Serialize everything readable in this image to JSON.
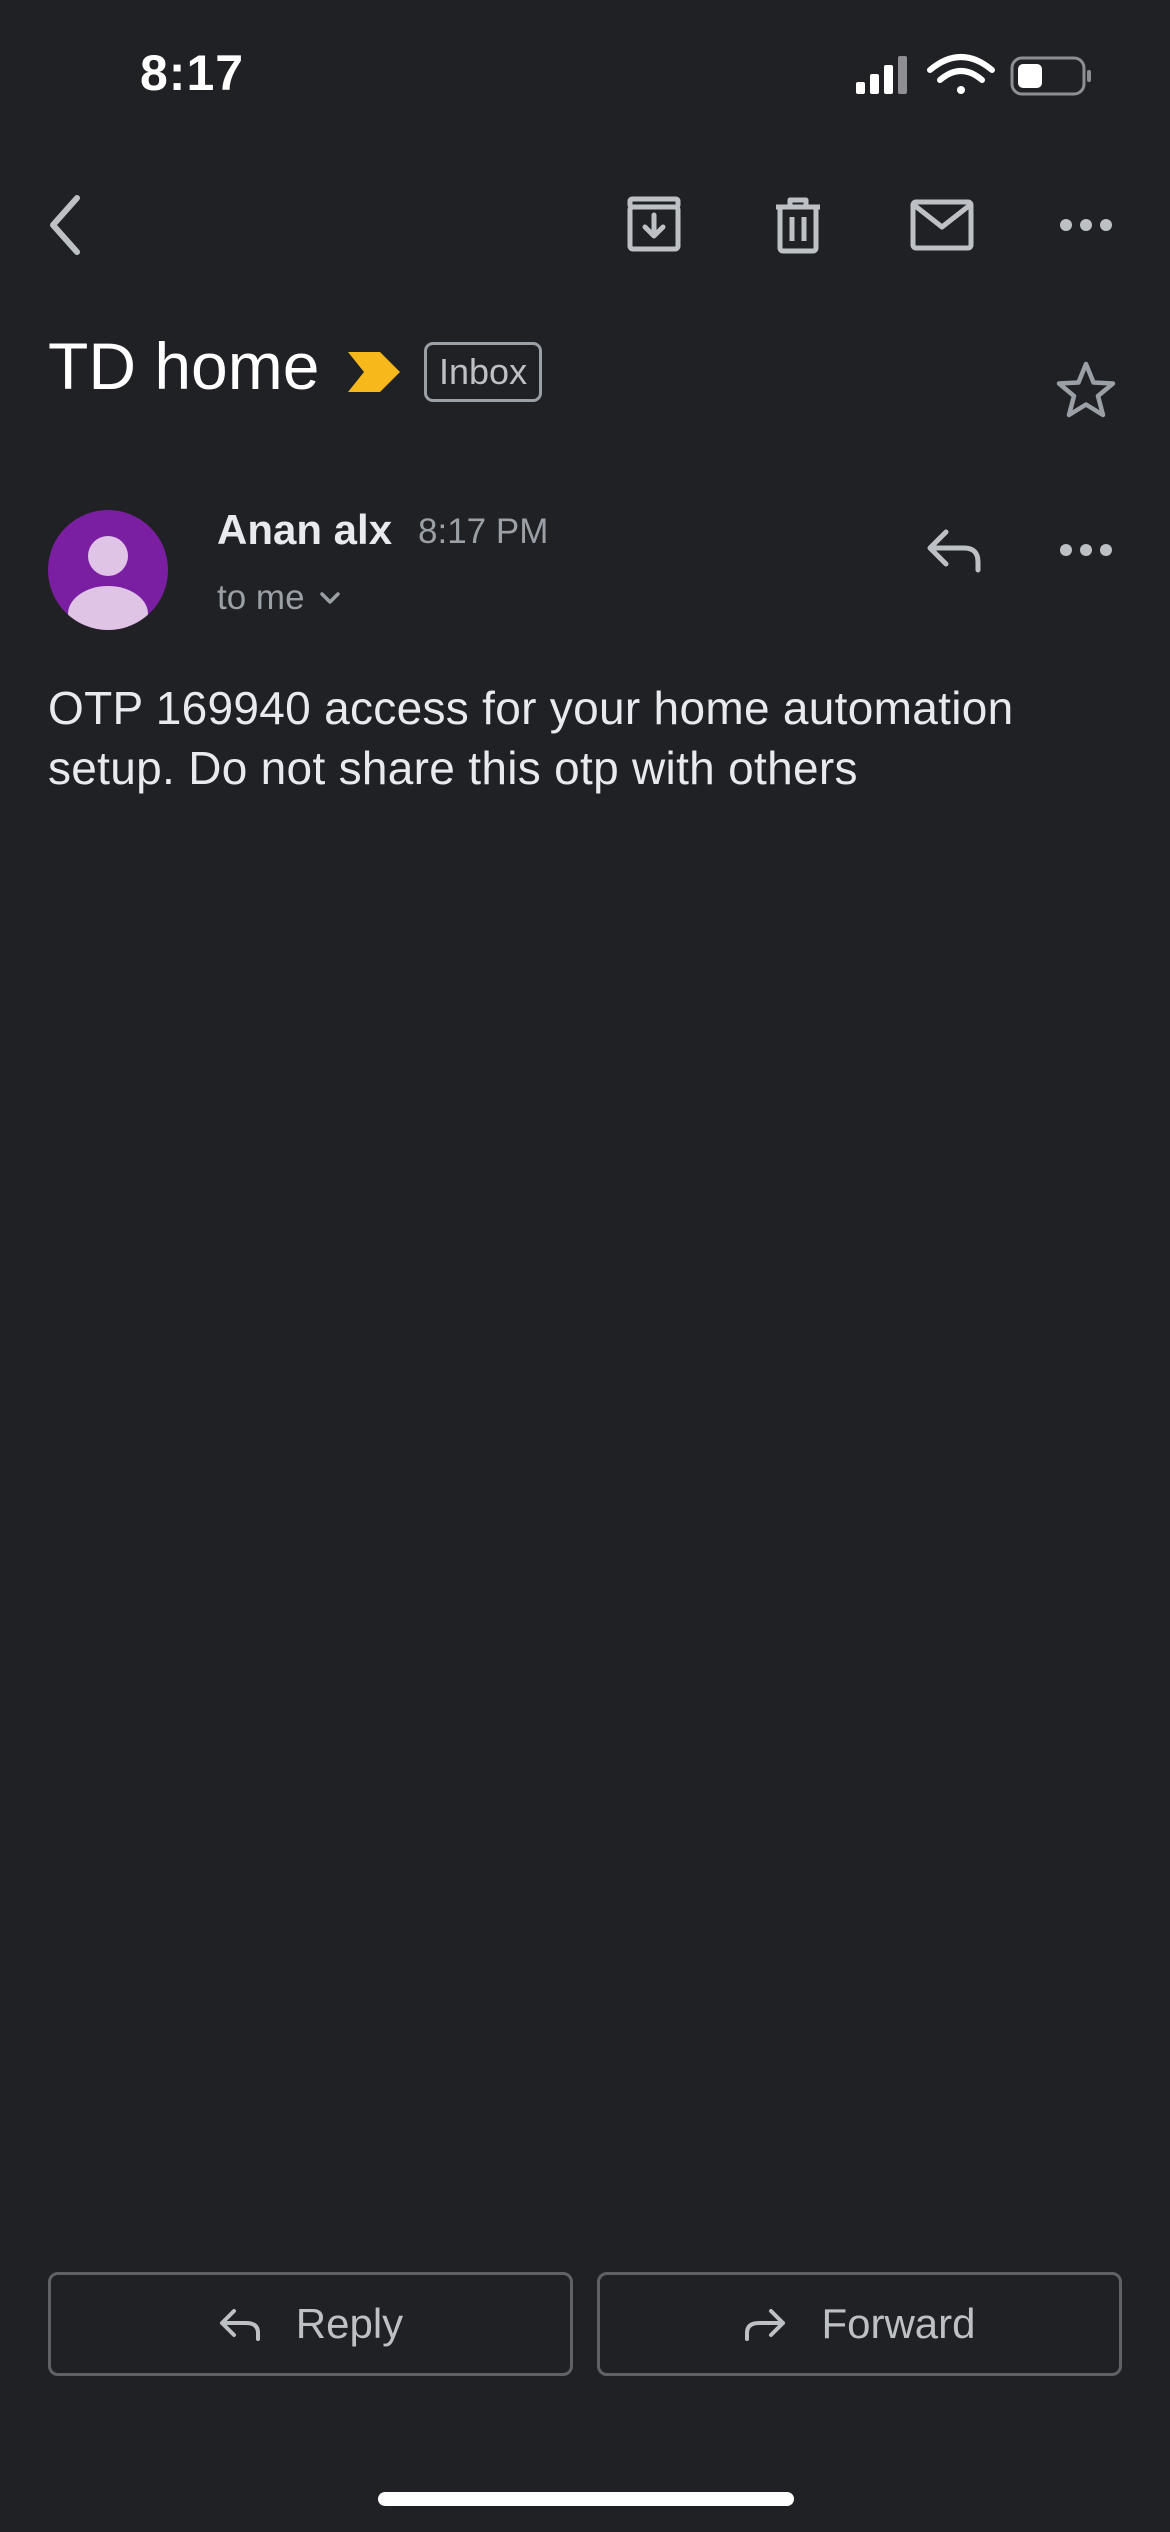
{
  "status_bar": {
    "time": "8:17"
  },
  "toolbar": {
    "icons": [
      "back-icon",
      "archive-icon",
      "trash-icon",
      "mail-icon",
      "more-icon"
    ]
  },
  "message": {
    "subject": "TD home",
    "label": "Inbox",
    "important_color": "#f6b81b",
    "sender": {
      "name": "Anan alx",
      "time": "8:17 PM",
      "recipients": "to me",
      "avatar_color": "#7b1fa2"
    },
    "body": "OTP 169940 access for your home automation setup. Do not share this otp with others"
  },
  "actions": {
    "reply_label": "Reply",
    "forward_label": "Forward"
  }
}
